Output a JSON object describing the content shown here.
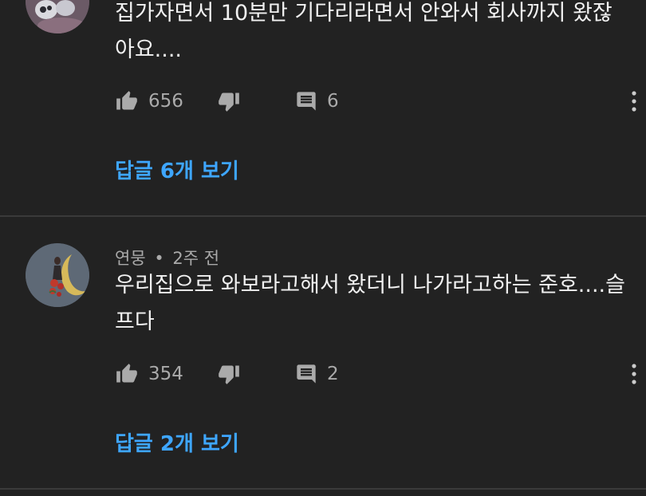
{
  "comments": [
    {
      "author": "",
      "time": "",
      "text": "집가자면서 10분만 기다리라면서 안와서 회사까지 왔잖아요....",
      "likes": "656",
      "reply_count": "6",
      "view_replies": "답글 6개 보기"
    },
    {
      "author": "연뭉",
      "time": "2주 전",
      "separator": "•",
      "text": "우리집으로 와보라고해서 왔더니 나가라고하는 준호....슬프다",
      "likes": "354",
      "reply_count": "2",
      "view_replies": "답글 2개 보기"
    }
  ],
  "icons": {
    "like": "thumb-up-icon",
    "dislike": "thumb-down-icon",
    "reply": "comment-icon",
    "more": "more-vertical-icon"
  },
  "colors": {
    "background": "#222222",
    "text": "#f1f1f1",
    "secondary": "#aaaaaa",
    "link": "#3ea6ff",
    "divider": "#3a3a3a"
  }
}
